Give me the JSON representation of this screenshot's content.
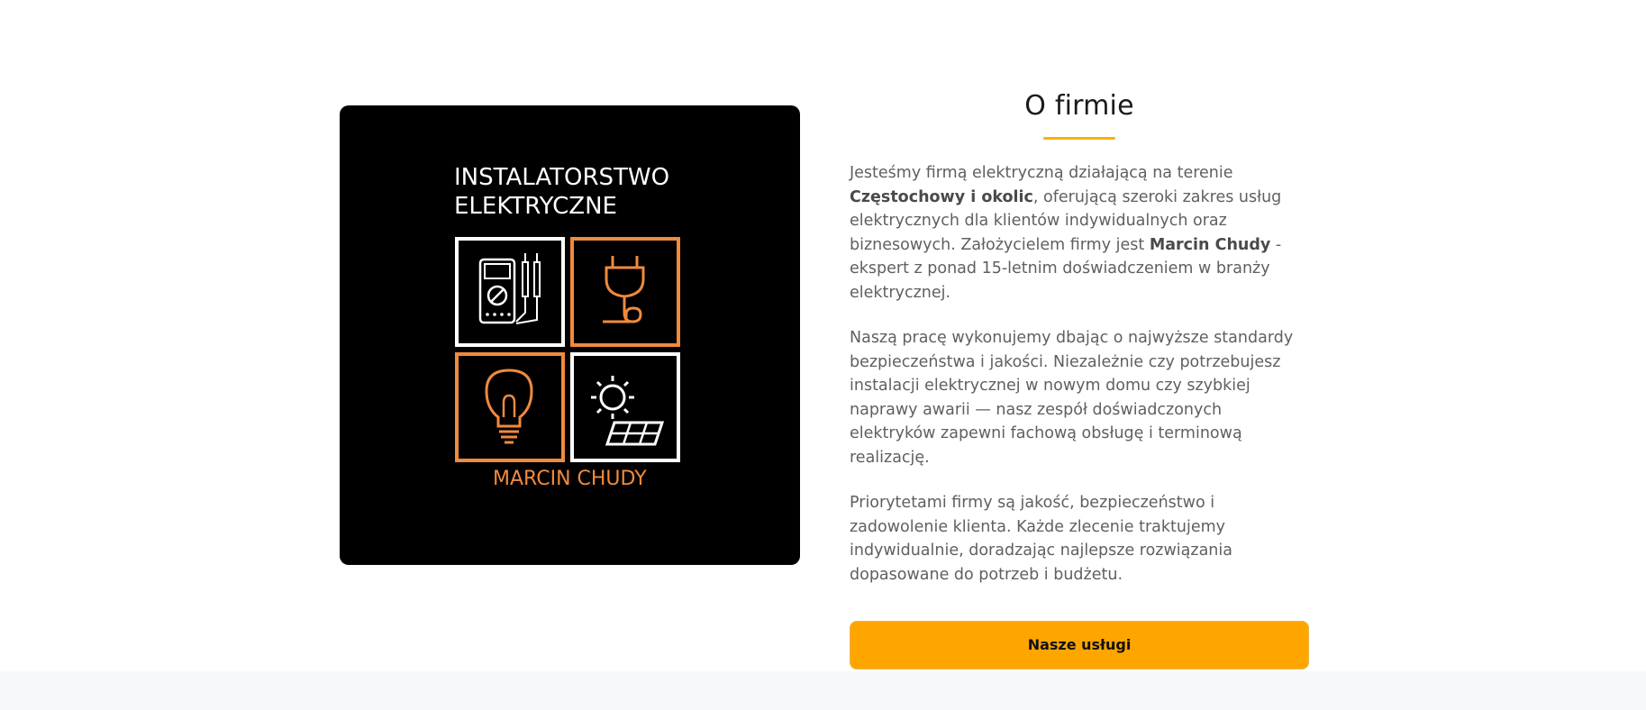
{
  "logo": {
    "line1": "INSTALATORSTWO",
    "line2": "ELEKTRYCZNE",
    "name": "MARCIN CHUDY",
    "accent_color": "#f08a3c",
    "line_color": "#ffffff",
    "icons": [
      "multimeter-icon",
      "plug-icon",
      "light-bulb-icon",
      "solar-panel-icon"
    ]
  },
  "about": {
    "title": "O firmie",
    "p1": {
      "t1": "Jesteśmy firmą elektryczną działającą na terenie ",
      "b1": "Częstochowy i okolic",
      "t2": ", oferującą szeroki zakres usług elektrycznych dla klientów indywidualnych oraz biznesowych. Założycielem firmy jest ",
      "b2": "Marcin Chudy",
      "t3": " - ekspert z ponad 15-letnim doświadczeniem w branży elektrycznej."
    },
    "p2": "Naszą pracę wykonujemy dbając o najwyższe standardy bezpieczeństwa i jakości. Niezależnie czy potrzebujesz instalacji elektrycznej w nowym domu czy szybkiej naprawy awarii — nasz zespół doświadczonych elektryków zapewni fachową obsługę i terminową realizację.",
    "p3": "Priorytetami firmy są jakość, bezpieczeństwo i zadowolenie klienta. Każde zlecenie traktujemy indywidualnie, doradzając najlepsze rozwiązania dopasowane do potrzeb i budżetu.",
    "button_label": "Nasze usługi"
  },
  "colors": {
    "accent": "#f5b301",
    "button": "#ffa500",
    "footer_bg": "#f7f8fa"
  }
}
